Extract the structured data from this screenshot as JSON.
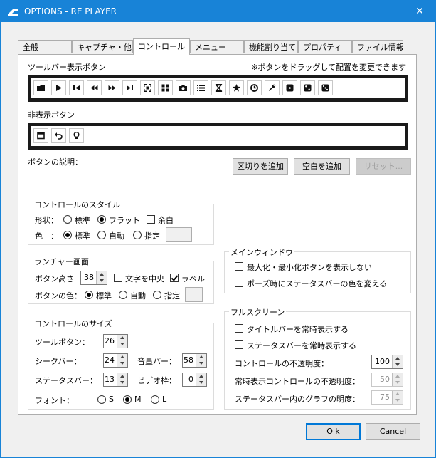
{
  "window": {
    "title": "OPTIONS - RE PLAYER",
    "close_glyph": "✕"
  },
  "tabs": [
    {
      "label": "全般"
    },
    {
      "label": "キャプチャ・他"
    },
    {
      "label": "コントロール"
    },
    {
      "label": "メニュー"
    },
    {
      "label": "機能割り当て"
    },
    {
      "label": "プロパティ"
    },
    {
      "label": "ファイル情報"
    }
  ],
  "toolbar_section": {
    "title": "ツールバー表示ボタン",
    "hint": "※ボタンをドラッグして配置を変更できます",
    "buttons": [
      "open-folder-icon",
      "play-icon",
      "skip-back-icon",
      "rewind-icon",
      "fast-forward-icon",
      "skip-forward-icon",
      "fullscreen-icon",
      "grid-icon",
      "camera-icon",
      "list-icon",
      "hourglass-icon",
      "star-icon",
      "clock-icon",
      "wrench-icon",
      "dice-1-icon",
      "dice-2-icon",
      "dice-3-icon"
    ]
  },
  "hidden_section": {
    "title": "非表示ボタン",
    "buttons": [
      "window-icon",
      "undo-icon",
      "bulb-icon"
    ]
  },
  "description_label": "ボタンの説明：",
  "actions": {
    "add_separator": "区切りを追加",
    "add_space": "空白を追加",
    "reset": "リセット..."
  },
  "control_style": {
    "title": "コントロールのスタイル",
    "shape_label": "形状：",
    "shape_options": [
      "標準",
      "フラット"
    ],
    "margin_label": "余白",
    "color_label": "色　：",
    "color_options": [
      "標準",
      "自動",
      "指定"
    ]
  },
  "launcher": {
    "title": "ランチャー画面",
    "btn_height_label": "ボタン高さ",
    "btn_height_value": "38",
    "center_text_label": "文字を中央",
    "label_label": "ラベル",
    "btn_color_label": "ボタンの色：",
    "color_options": [
      "標準",
      "自動",
      "指定"
    ]
  },
  "control_size": {
    "title": "コントロールのサイズ",
    "toolbar_btn_label": "ツールボタン：",
    "toolbar_btn_value": "26",
    "seekbar_label": "シークバー：",
    "seekbar_value": "24",
    "volume_label": "音量バー：",
    "volume_value": "58",
    "statusbar_label": "ステータスバー：",
    "statusbar_value": "13",
    "video_frame_label": "ビデオ枠：",
    "video_frame_value": "0",
    "font_label": "フォント：",
    "font_options": [
      "S",
      "M",
      "L"
    ]
  },
  "main_window": {
    "title": "メインウィンドウ",
    "hide_minmax_label": "最大化・最小化ボタンを表示しない",
    "pause_statusbar_label": "ポーズ時にステータスバーの色を変える"
  },
  "fullscreen": {
    "title": "フルスクリーン",
    "always_titlebar_label": "タイトルバーを常時表示する",
    "always_statusbar_label": "ステータスバーを常時表示する",
    "opacity_label": "コントロールの不透明度：",
    "opacity_value": "100",
    "always_opacity_label": "常時表示コントロールの不透明度：",
    "always_opacity_value": "50",
    "graph_brightness_label": "ステータスバー内のグラフの明度：",
    "graph_brightness_value": "75"
  },
  "footer": {
    "ok": "O k",
    "cancel": "Cancel"
  }
}
